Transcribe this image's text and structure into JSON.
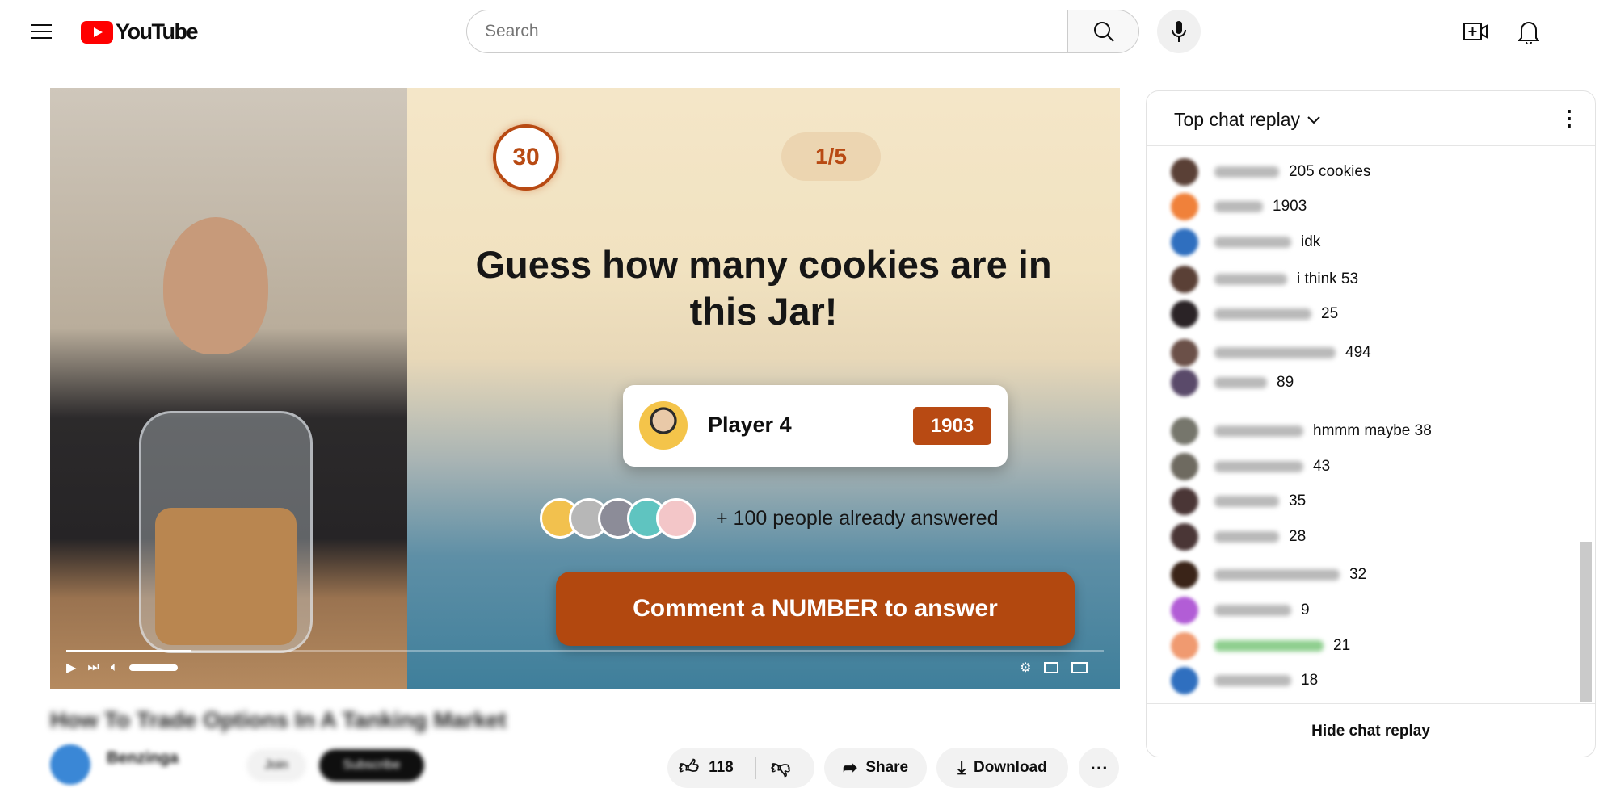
{
  "header": {
    "logo_text": "YouTube",
    "search_placeholder": "Search",
    "icons": [
      "menu-icon",
      "search-icon",
      "mic-icon",
      "create-icon",
      "bell-icon"
    ],
    "brand_color": "#ff0000"
  },
  "video": {
    "timer": "30",
    "question_index": "1/5",
    "question": "Guess how many cookies are in this Jar!",
    "player": {
      "name": "Player 4",
      "answer": "1903"
    },
    "answered_text": "+ 100 people already answered",
    "cta": "Comment a NUMBER to answer",
    "accent_color": "#b84a13",
    "progress_fraction": 0.12
  },
  "below": {
    "title": "How To Trade Options In A Tanking Market",
    "channel": "Benzinga",
    "join": "Join",
    "subscribe": "Subscribe",
    "likes": "118",
    "share": "Share",
    "download": "Download"
  },
  "chat": {
    "title": "Top chat replay",
    "hide_label": "Hide chat replay",
    "messages": [
      {
        "text": "205 cookies",
        "color": "#5a4036"
      },
      {
        "text": "1903",
        "color": "#f0813a"
      },
      {
        "text": "idk",
        "color": "#2f6fbf"
      },
      {
        "text": "i think 53",
        "color": "#5a4036"
      },
      {
        "text": "25",
        "color": "#2a2326"
      },
      {
        "text": "494",
        "color": "#6b5048"
      },
      {
        "text": "89",
        "color": "#5a4a6a"
      },
      {
        "text": "hmmm maybe 38",
        "color": "#76766c"
      },
      {
        "text": "43",
        "color": "#6e6a60"
      },
      {
        "text": "35",
        "color": "#4a3636"
      },
      {
        "text": "28",
        "color": "#4a3636"
      },
      {
        "text": "32",
        "color": "#3a2418"
      },
      {
        "text": "9",
        "color": "#b25dd6"
      },
      {
        "text": "21",
        "color": "#f09a70"
      },
      {
        "text": "18",
        "color": "#2f6fbf"
      }
    ]
  }
}
